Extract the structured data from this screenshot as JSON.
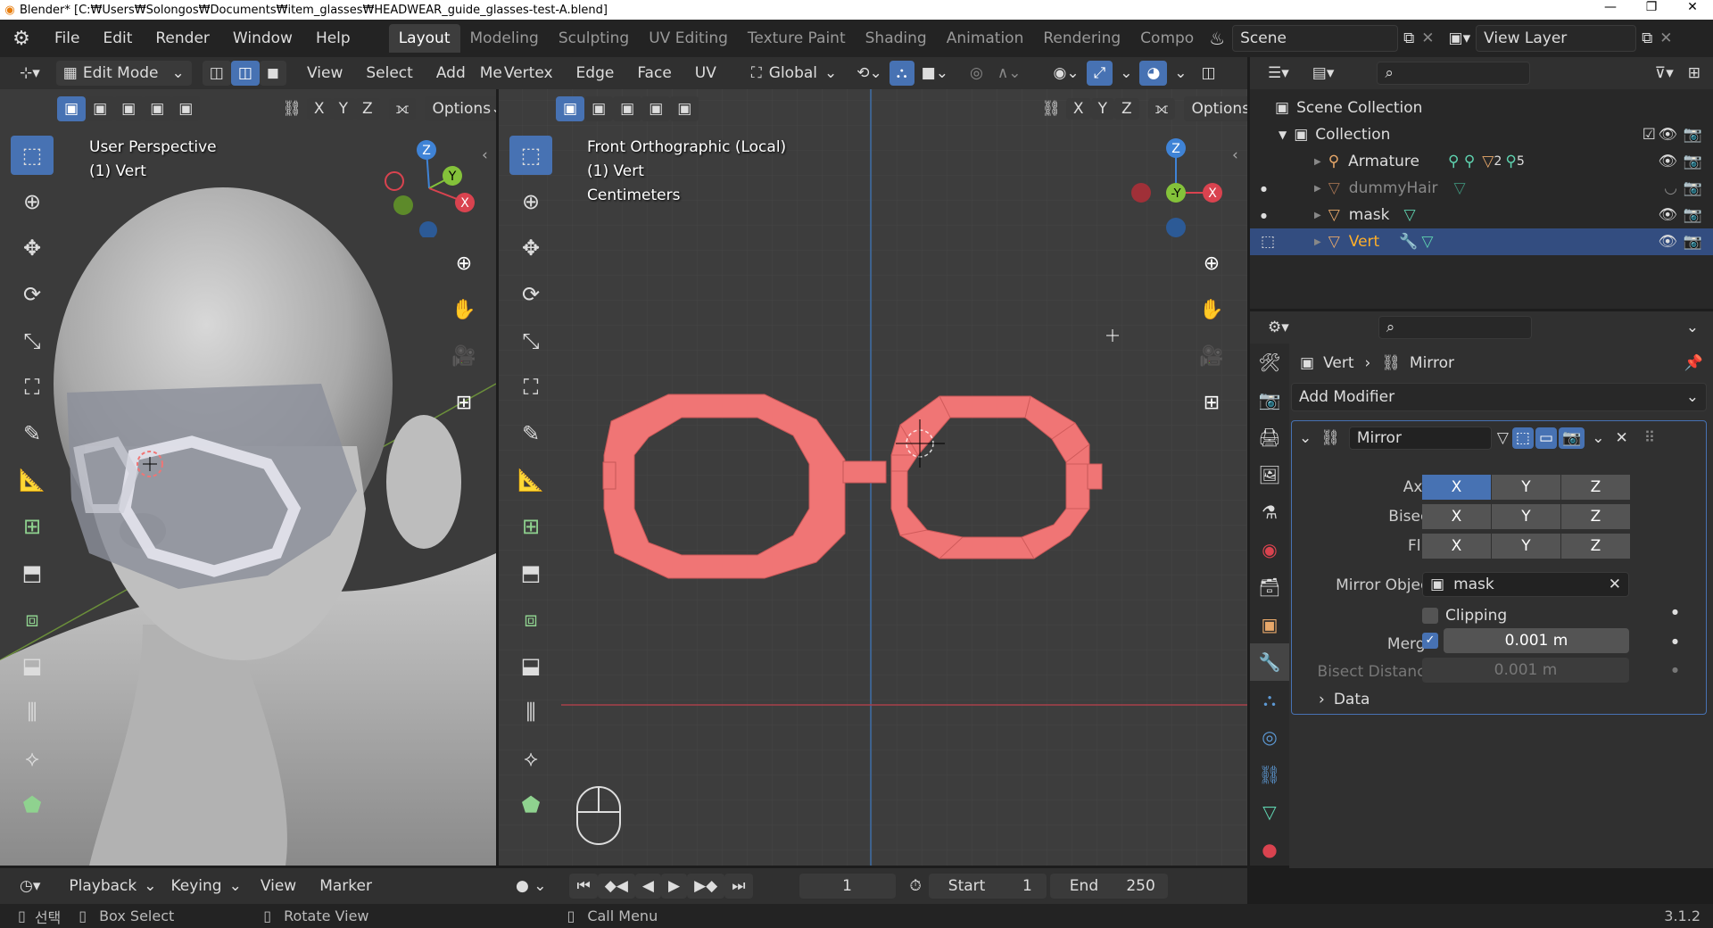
{
  "window": {
    "title": "Blender* [C:₩Users₩Solongos₩Documents₩item_glasses₩HEADWEAR_guide_glasses-test-A.blend]",
    "controls": [
      "—",
      "❐",
      "✕"
    ]
  },
  "menus": [
    "File",
    "Edit",
    "Render",
    "Window",
    "Help"
  ],
  "workspaces": [
    {
      "label": "Layout",
      "active": true
    },
    {
      "label": "Modeling"
    },
    {
      "label": "Sculpting"
    },
    {
      "label": "UV Editing"
    },
    {
      "label": "Texture Paint"
    },
    {
      "label": "Shading"
    },
    {
      "label": "Animation"
    },
    {
      "label": "Rendering"
    },
    {
      "label": "Compo"
    }
  ],
  "scene": {
    "label": "Scene"
  },
  "view_layer": {
    "label": "View Layer"
  },
  "header": {
    "mode": "Edit Mode",
    "view": "View",
    "select": "Select",
    "add": "Add",
    "mesh": "Me",
    "vertex": "Vertex",
    "edge": "Edge",
    "face": "Face",
    "uv": "UV",
    "orientation": "Global"
  },
  "viewport_left": {
    "perspective": "User Perspective",
    "object": "(1) Vert",
    "options": "Options",
    "axes": [
      "X",
      "Y",
      "Z"
    ]
  },
  "viewport_right": {
    "perspective": "Front Orthographic (Local)",
    "object": "(1) Vert",
    "units": "Centimeters",
    "options": "Options",
    "axes": [
      "X",
      "Y",
      "Z"
    ]
  },
  "outliner": {
    "scene_collection": "Scene Collection",
    "collection": "Collection",
    "items": [
      {
        "label": "Armature",
        "badges": [
          "2",
          "5"
        ]
      },
      {
        "label": "dummyHair",
        "dim": true
      },
      {
        "label": "mask"
      },
      {
        "label": "Vert",
        "selected": true
      }
    ]
  },
  "properties": {
    "breadcrumb_object": "Vert",
    "breadcrumb_modifier": "Mirror",
    "add_modifier": "Add Modifier",
    "modifier_name": "Mirror",
    "axis_label": "Axis",
    "bisect_label": "Bisect",
    "flip_label": "Flip",
    "axis": [
      "X",
      "Y",
      "Z"
    ],
    "mirror_object_label": "Mirror Object",
    "mirror_object": "mask",
    "clipping_label": "Clipping",
    "merge_label": "Merge",
    "merge_value": "0.001 m",
    "bisect_distance_label": "Bisect Distance",
    "bisect_distance_value": "0.001 m",
    "data_label": "Data"
  },
  "timeline": {
    "playback": "Playback",
    "keying": "Keying",
    "view": "View",
    "marker": "Marker",
    "current_frame": "1",
    "start_label": "Start",
    "start": "1",
    "end_label": "End",
    "end": "250"
  },
  "statusbar": {
    "select": "선택",
    "box_select": "Box Select",
    "rotate_view": "Rotate View",
    "call_menu": "Call Menu",
    "version": "3.1.2"
  },
  "colors": {
    "accent": "#4772b3",
    "mesh": "#f07575",
    "x_axis": "#d9434f",
    "y_axis": "#84c23a",
    "z_axis": "#3f83d6"
  }
}
